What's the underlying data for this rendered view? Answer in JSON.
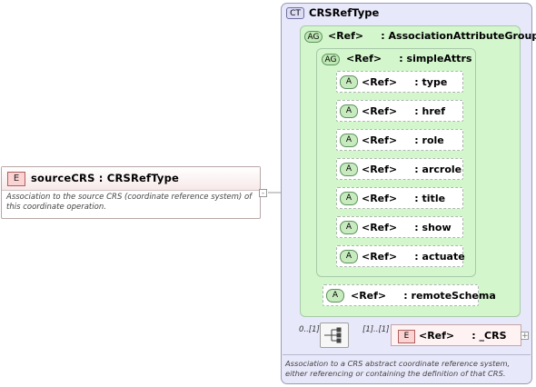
{
  "element": {
    "badge": "E",
    "title": "sourceCRS : CRSRefType",
    "documentation": "Association to the source CRS (coordinate reference system) of this coordinate operation.",
    "expand_symbol": "-"
  },
  "complex_type": {
    "badge": "CT",
    "title": "CRSRefType",
    "documentation": "Association to a CRS abstract coordinate reference system, either referencing or containing the definition of that CRS."
  },
  "association_group": {
    "badge": "AG",
    "title": "<Ref>     : AssociationAttributeGroup"
  },
  "simple_attrs": {
    "badge": "AG",
    "title": "<Ref>     : simpleAttrs",
    "attributes": [
      {
        "badge": "A",
        "label": "<Ref>     : type"
      },
      {
        "badge": "A",
        "label": "<Ref>     : href"
      },
      {
        "badge": "A",
        "label": "<Ref>     : role"
      },
      {
        "badge": "A",
        "label": "<Ref>     : arcrole"
      },
      {
        "badge": "A",
        "label": "<Ref>     : title"
      },
      {
        "badge": "A",
        "label": "<Ref>     : show"
      },
      {
        "badge": "A",
        "label": "<Ref>     : actuate"
      }
    ]
  },
  "remote_schema": {
    "badge": "A",
    "label": "<Ref>     : remoteSchema"
  },
  "sequence": {
    "cardinality_left": "0..[1]",
    "cardinality_right": "[1]..[1]"
  },
  "ref_element": {
    "badge": "E",
    "label": "<Ref>     : _CRS",
    "expand_symbol": "+"
  }
}
